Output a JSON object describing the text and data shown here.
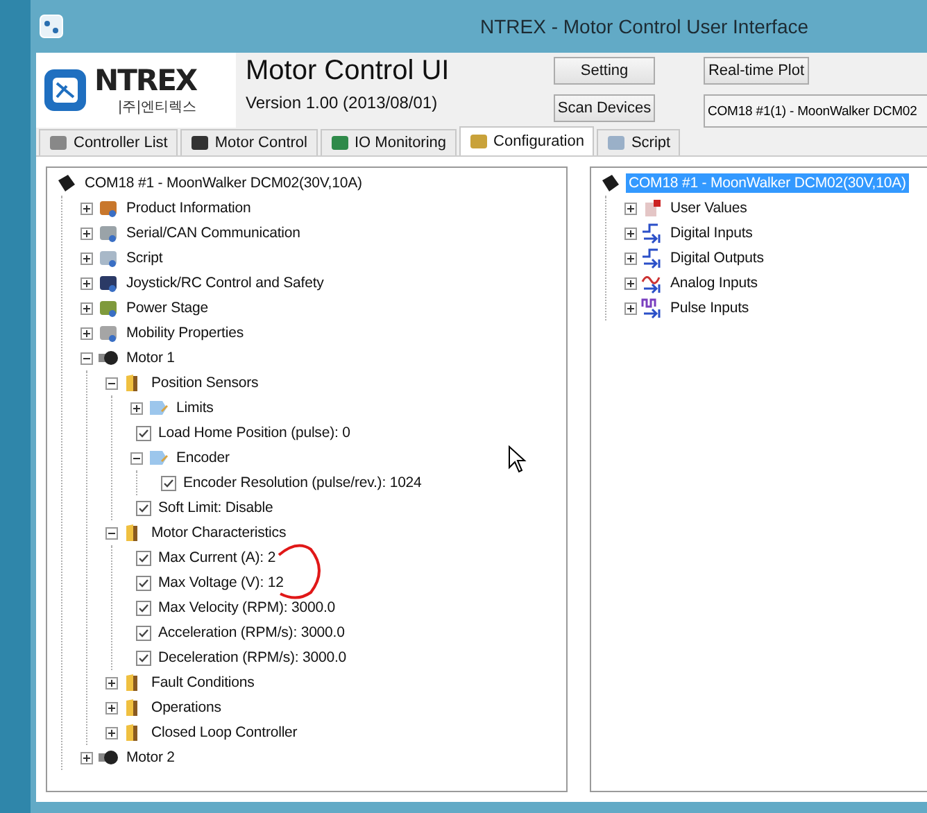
{
  "window": {
    "title": "NTREX - Motor Control User Interface"
  },
  "header": {
    "logo_name": "NTREX",
    "logo_sub": "|주|엔티렉스",
    "app_title": "Motor Control UI",
    "version": "Version 1.00 (2013/08/01)"
  },
  "buttons": [
    {
      "label": "Setting"
    },
    {
      "label": "Scan Devices"
    },
    {
      "label": "Real-time Plot"
    }
  ],
  "device_select": {
    "value": "COM18 #1(1) - MoonWalker DCM02"
  },
  "tabs": [
    {
      "label": "Controller List",
      "selected": false
    },
    {
      "label": "Motor Control",
      "selected": false
    },
    {
      "label": "IO Monitoring",
      "selected": false
    },
    {
      "label": "Configuration",
      "selected": true
    },
    {
      "label": "Script",
      "selected": false
    }
  ],
  "config_tree": {
    "label": "COM18 #1 - MoonWalker DCM02(30V,10A)",
    "kind": "device",
    "selected": false,
    "children": [
      {
        "label": "Product Information",
        "kind": "category",
        "expanded": false
      },
      {
        "label": "Serial/CAN Communication",
        "kind": "category",
        "expanded": false
      },
      {
        "label": "Script",
        "kind": "category",
        "expanded": false
      },
      {
        "label": "Joystick/RC Control and Safety",
        "kind": "category",
        "expanded": false
      },
      {
        "label": "Power Stage",
        "kind": "category",
        "expanded": false
      },
      {
        "label": "Mobility Properties",
        "kind": "category",
        "expanded": false
      },
      {
        "label": "Motor 1",
        "kind": "motor",
        "expanded": true,
        "children": [
          {
            "label": "Position Sensors",
            "kind": "folder",
            "expanded": true,
            "children": [
              {
                "label": "Limits",
                "kind": "page",
                "expanded": false
              },
              {
                "label": "Load Home Position (pulse): 0",
                "kind": "param",
                "checked": true
              },
              {
                "label": "Encoder",
                "kind": "page",
                "expanded": true,
                "children": [
                  {
                    "label": "Encoder Resolution (pulse/rev.): 1024",
                    "kind": "param",
                    "checked": true
                  }
                ]
              },
              {
                "label": "Soft Limit: Disable",
                "kind": "param",
                "checked": true
              }
            ]
          },
          {
            "label": "Motor Characteristics",
            "kind": "folder",
            "expanded": true,
            "children": [
              {
                "label": "Max Current (A): 2",
                "kind": "param",
                "checked": true
              },
              {
                "label": "Max Voltage (V): 12",
                "kind": "param",
                "checked": true
              },
              {
                "label": "Max Velocity (RPM): 3000.0",
                "kind": "param",
                "checked": true
              },
              {
                "label": "Acceleration (RPM/s): 3000.0",
                "kind": "param",
                "checked": true
              },
              {
                "label": "Deceleration (RPM/s): 3000.0",
                "kind": "param",
                "checked": true
              }
            ]
          },
          {
            "label": "Fault Conditions",
            "kind": "folder",
            "expanded": false
          },
          {
            "label": "Operations",
            "kind": "folder",
            "expanded": false
          },
          {
            "label": "Closed Loop Controller",
            "kind": "folder",
            "expanded": false
          }
        ]
      },
      {
        "label": "Motor 2",
        "kind": "motor",
        "expanded": false
      }
    ]
  },
  "io_tree": {
    "label": "COM18 #1 - MoonWalker DCM02(30V,10A)",
    "kind": "device",
    "selected": true,
    "children": [
      {
        "label": "User Values",
        "kind": "user",
        "expanded": false
      },
      {
        "label": "Digital Inputs",
        "kind": "din",
        "expanded": false
      },
      {
        "label": "Digital Outputs",
        "kind": "dout",
        "expanded": false
      },
      {
        "label": "Analog Inputs",
        "kind": "ain",
        "expanded": false
      },
      {
        "label": "Pulse Inputs",
        "kind": "pin",
        "expanded": false
      }
    ]
  }
}
